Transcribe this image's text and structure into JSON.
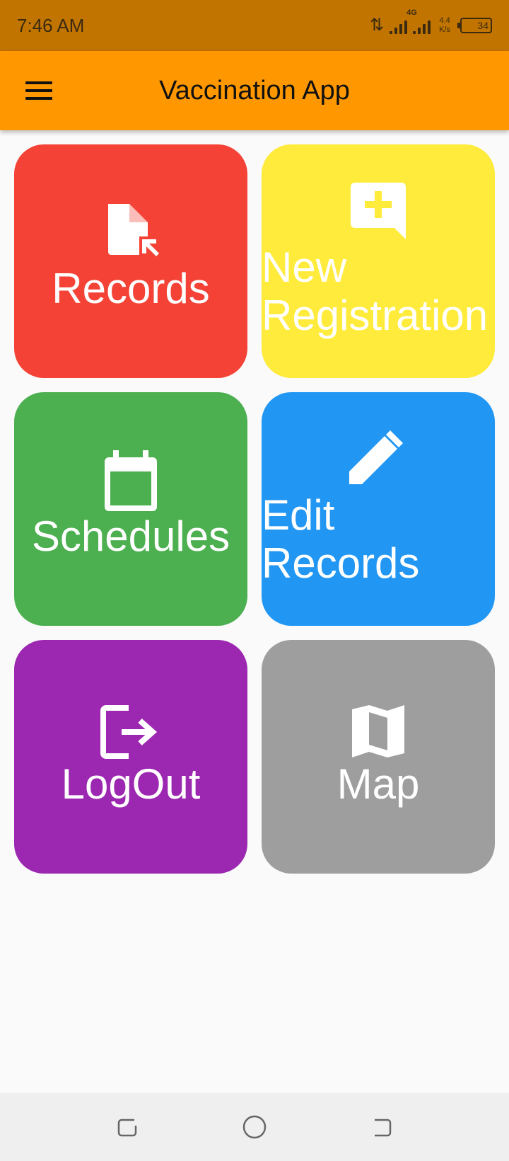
{
  "status_bar": {
    "time": "7:46 AM",
    "network": "4G",
    "speed_value": "4.4",
    "speed_unit": "K/s",
    "battery": "34"
  },
  "app_bar": {
    "title": "Vaccination App",
    "menu_icon": "hamburger-menu-icon"
  },
  "tiles": [
    {
      "label": "Records",
      "icon": "file-pointer-icon",
      "color": "#f44336"
    },
    {
      "label": "New Registration",
      "line1": "New",
      "line2": "Registration",
      "icon": "add-comment-icon",
      "color": "#ffeb3b"
    },
    {
      "label": "Schedules",
      "icon": "calendar-icon",
      "color": "#4caf50"
    },
    {
      "label": "Edit Records",
      "line1": "Edit",
      "line2": "Records",
      "icon": "pencil-icon",
      "color": "#2196f3"
    },
    {
      "label": "LogOut",
      "icon": "logout-icon",
      "color": "#9c27b0"
    },
    {
      "label": "Map",
      "icon": "map-icon",
      "color": "#9e9e9e"
    }
  ],
  "colors": {
    "status_bar": "#c17400",
    "app_bar": "#ff9800",
    "background": "#fafafa",
    "nav_bar": "#efefef"
  },
  "nav_bar": {
    "buttons": [
      "recent-apps-icon",
      "home-icon",
      "back-icon"
    ]
  }
}
